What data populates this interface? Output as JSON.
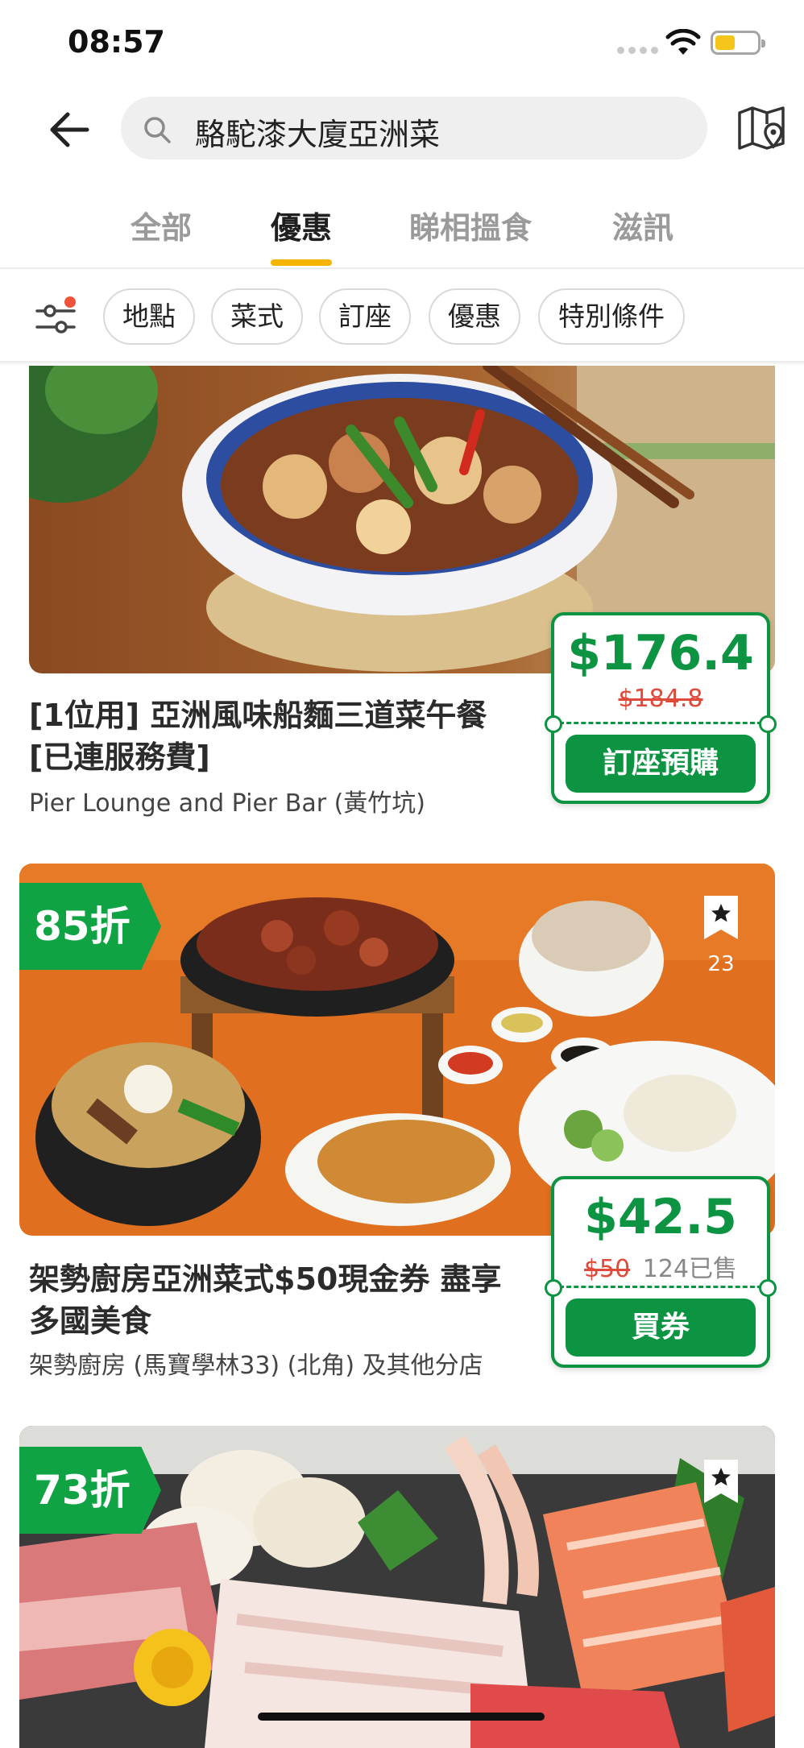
{
  "status_bar": {
    "time": "08:57"
  },
  "search": {
    "query": "駱駝漆大廈亞洲菜"
  },
  "tabs": [
    {
      "label": "全部",
      "active": false
    },
    {
      "label": "優惠",
      "active": true
    },
    {
      "label": "睇相搵食",
      "active": false
    },
    {
      "label": "滋訊",
      "active": false
    }
  ],
  "filters": [
    "地點",
    "菜式",
    "訂座",
    "優惠",
    "特別條件"
  ],
  "colors": {
    "accent_green": "#0c9443",
    "tab_indicator": "#f5b400",
    "strike_price": "#e04a3b"
  },
  "offers": [
    {
      "title_line1": "[1位用] 亞洲風味船麵三道菜午餐",
      "title_line2": "[已連服務費]",
      "restaurant": "Pier Lounge and Pier Bar (黃竹坑)",
      "price": "$176.4",
      "original_price": "$184.8",
      "button": "訂座預購"
    },
    {
      "discount": "85折",
      "bookmarks": "23",
      "title_line1": "架勢廚房亞洲菜式$50現金券 盡享",
      "title_line2": "多國美食",
      "restaurant": "架勢廚房 (馬寶學林33) (北角) 及其他分店",
      "price": "$42.5",
      "original_price": "$50",
      "sold": "124已售",
      "button": "買券"
    },
    {
      "discount": "73折"
    }
  ]
}
